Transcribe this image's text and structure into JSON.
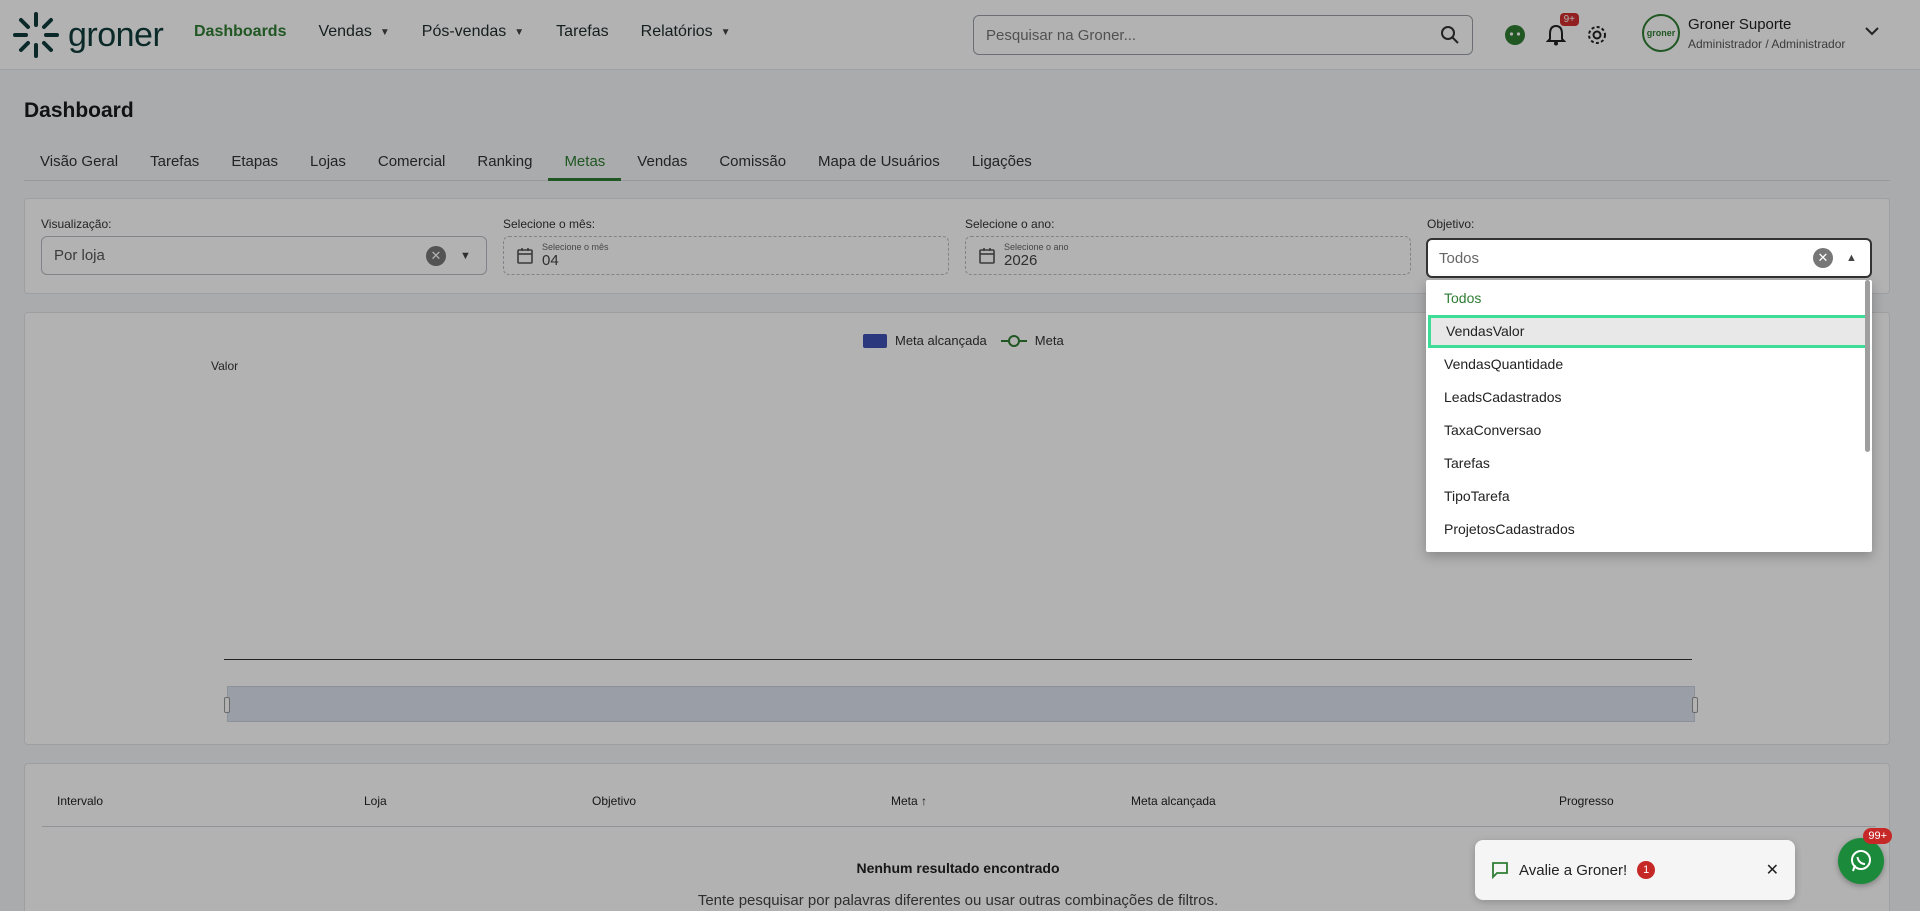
{
  "header": {
    "logo_text": "groner",
    "nav": [
      {
        "label": "Dashboards",
        "has_caret": false
      },
      {
        "label": "Vendas",
        "has_caret": true
      },
      {
        "label": "Pós-vendas",
        "has_caret": true
      },
      {
        "label": "Tarefas",
        "has_caret": false
      },
      {
        "label": "Relatórios",
        "has_caret": true
      }
    ],
    "search_placeholder": "Pesquisar na Groner...",
    "notif_badge": "9+",
    "user_name": "Groner Suporte",
    "user_role": "Administrador / Administrador",
    "avatar_text": "groner"
  },
  "page": {
    "title": "Dashboard",
    "tabs": [
      "Visão Geral",
      "Tarefas",
      "Etapas",
      "Lojas",
      "Comercial",
      "Ranking",
      "Metas",
      "Vendas",
      "Comissão",
      "Mapa de Usuários",
      "Ligações"
    ],
    "active_tab": "Metas"
  },
  "filters": {
    "visualizacao": {
      "label": "Visualização:",
      "value": "Por loja"
    },
    "mes": {
      "label": "Selecione o mês:",
      "small": "Selecione o mês",
      "value": "04"
    },
    "ano": {
      "label": "Selecione o ano:",
      "small": "Selecione o ano",
      "value": "2026"
    },
    "objetivo": {
      "label": "Objetivo:",
      "value": "Todos"
    }
  },
  "chart": {
    "legend_bar": "Meta alcançada",
    "legend_line": "Meta",
    "ylabel": "Valor"
  },
  "chart_data": {
    "type": "bar",
    "categories": [],
    "series": [
      {
        "name": "Meta alcançada",
        "values": []
      },
      {
        "name": "Meta",
        "values": []
      }
    ],
    "ylabel": "Valor"
  },
  "table": {
    "headers": [
      "Intervalo",
      "Loja",
      "Objetivo",
      "Meta",
      "Meta alcançada",
      "Progresso"
    ],
    "empty_title": "Nenhum resultado encontrado",
    "empty_subtitle": "Tente pesquisar por palavras diferentes ou usar outras combinações de filtros."
  },
  "dropdown": {
    "options": [
      "Todos",
      "VendasValor",
      "VendasQuantidade",
      "LeadsCadastrados",
      "TaxaConversao",
      "Tarefas",
      "TipoTarefa",
      "ProjetosCadastrados"
    ],
    "selected": "Todos",
    "hovered": "VendasValor"
  },
  "toast": {
    "text": "Avalie a Groner!",
    "count": "1"
  },
  "whatsapp_badge": "99+",
  "colors": {
    "brand_green": "#2e7d32",
    "bar_blue": "#3f51b5",
    "highlight": "#3ddc97",
    "badge_red": "#d32f2f"
  }
}
